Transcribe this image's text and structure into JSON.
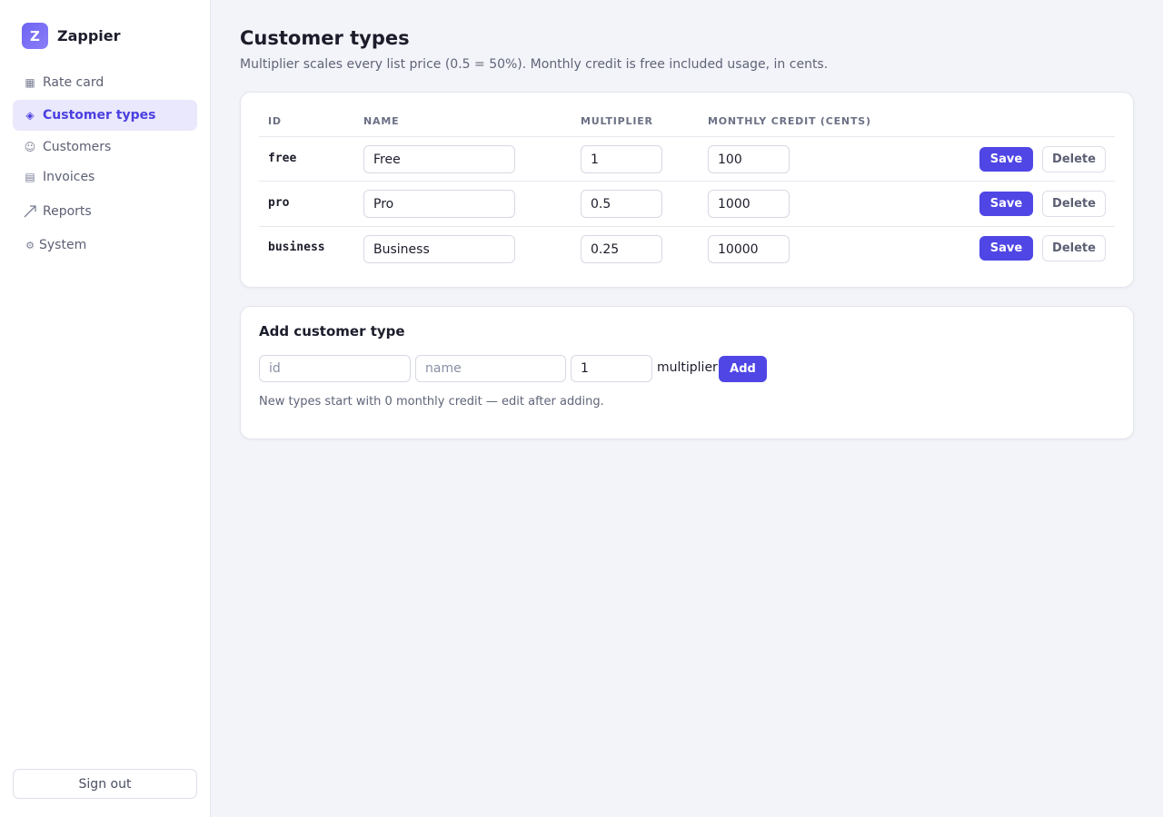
{
  "brand": {
    "logo_letter": "Z",
    "name": "Zappier"
  },
  "sidebar": {
    "items": [
      {
        "label": "Rate card",
        "icon": "grid-icon"
      },
      {
        "label": "Customer types",
        "icon": "diamond-icon",
        "active": true
      },
      {
        "label": "Customers",
        "icon": "smiley-icon"
      },
      {
        "label": "Invoices",
        "icon": "list-icon"
      },
      {
        "label": "Reports",
        "icon": "trend-arrow-icon"
      },
      {
        "label": "System",
        "icon": "gear-icon"
      }
    ],
    "sign_out": "Sign out"
  },
  "page": {
    "title": "Customer types",
    "subtitle": "Multiplier scales every list price (0.5 = 50%). Monthly credit is free included usage, in cents."
  },
  "table": {
    "headers": {
      "id": "ID",
      "name": "NAME",
      "multiplier": "MULTIPLIER",
      "credit": "MONTHLY CREDIT (CENTS)"
    },
    "rows": [
      {
        "id": "free",
        "name": "Free",
        "multiplier": "1",
        "credit": "100",
        "save": "Save",
        "delete": "Delete"
      },
      {
        "id": "pro",
        "name": "Pro",
        "multiplier": "0.5",
        "credit": "1000",
        "save": "Save",
        "delete": "Delete"
      },
      {
        "id": "business",
        "name": "Business",
        "multiplier": "0.25",
        "credit": "10000",
        "save": "Save",
        "delete": "Delete"
      }
    ]
  },
  "add": {
    "title": "Add customer type",
    "id_placeholder": "id",
    "name_placeholder": "name",
    "multiplier_value": "1",
    "multiplier_label": "multiplier",
    "add_button": "Add",
    "note": "New types start with 0 monthly credit — edit after adding."
  },
  "colors": {
    "accent": "#4f46e5",
    "active_nav_bg": "#e9e8fc",
    "page_bg": "#f3f4f9"
  }
}
